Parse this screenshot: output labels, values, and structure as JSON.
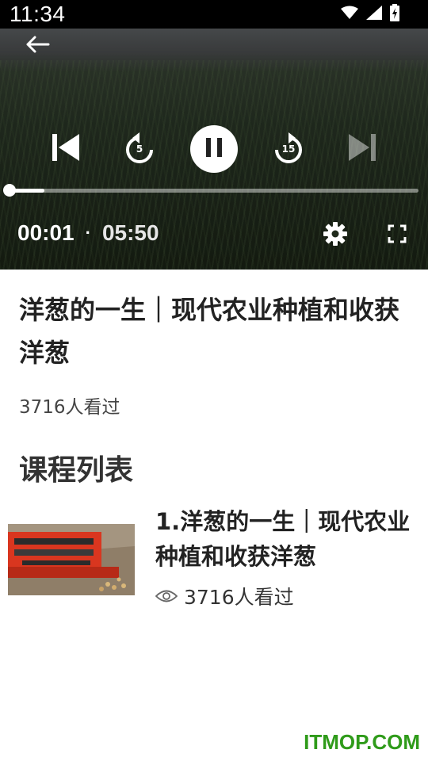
{
  "status_bar": {
    "time": "11:34"
  },
  "player": {
    "current_time": "00:01",
    "separator": "·",
    "duration": "05:50",
    "progress_fraction": 0.085,
    "rewind_seconds": "5",
    "forward_seconds": "15"
  },
  "video": {
    "title": "洋葱的一生｜现代农业种植和收获洋葱",
    "views": "3716人看过"
  },
  "course_list": {
    "heading": "课程列表",
    "items": [
      {
        "title": "1.洋葱的一生｜现代农业种植和收获洋葱",
        "views": "3716人看过"
      }
    ]
  },
  "watermark": "ITMOP.COM",
  "colors": {
    "watermark": "#2f9b1a",
    "status_bar": "#000000"
  }
}
